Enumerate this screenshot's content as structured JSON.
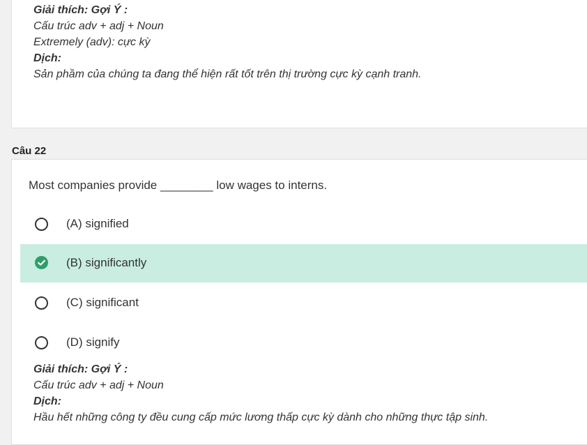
{
  "prev_card": {
    "explanation_heading": "Giải thích: Gợi Ý :",
    "explanation_lines": [
      "Cấu trúc adv + adj + Noun",
      "Extremely (adv): cực kỳ"
    ],
    "translation_heading": "Dịch:",
    "translation": "Sản phầm của chúng ta đang thể hiện rất tốt trên thị trường cực kỳ cạnh tranh."
  },
  "question": {
    "label": "Câu 22",
    "text": "Most companies provide ________ low wages to interns.",
    "options": [
      {
        "label": "(A) signified",
        "selected": false
      },
      {
        "label": "(B) significantly",
        "selected": true
      },
      {
        "label": "(C) significant",
        "selected": false
      },
      {
        "label": "(D) signify",
        "selected": false
      }
    ],
    "explanation_heading": "Giải thích: Gợi Ý :",
    "explanation_lines": [
      "Cấu trúc adv + adj + Noun"
    ],
    "translation_heading": "Dịch:",
    "translation": "Hầu hết những công ty đều cung cấp mức lương thấp cực kỳ dành cho những thực tập sinh."
  },
  "colors": {
    "selected_bg": "#c9ede1",
    "check_green": "#2e9e6a"
  },
  "icons": {
    "selected": "check-circle-icon",
    "unselected": "radio-empty-icon"
  }
}
